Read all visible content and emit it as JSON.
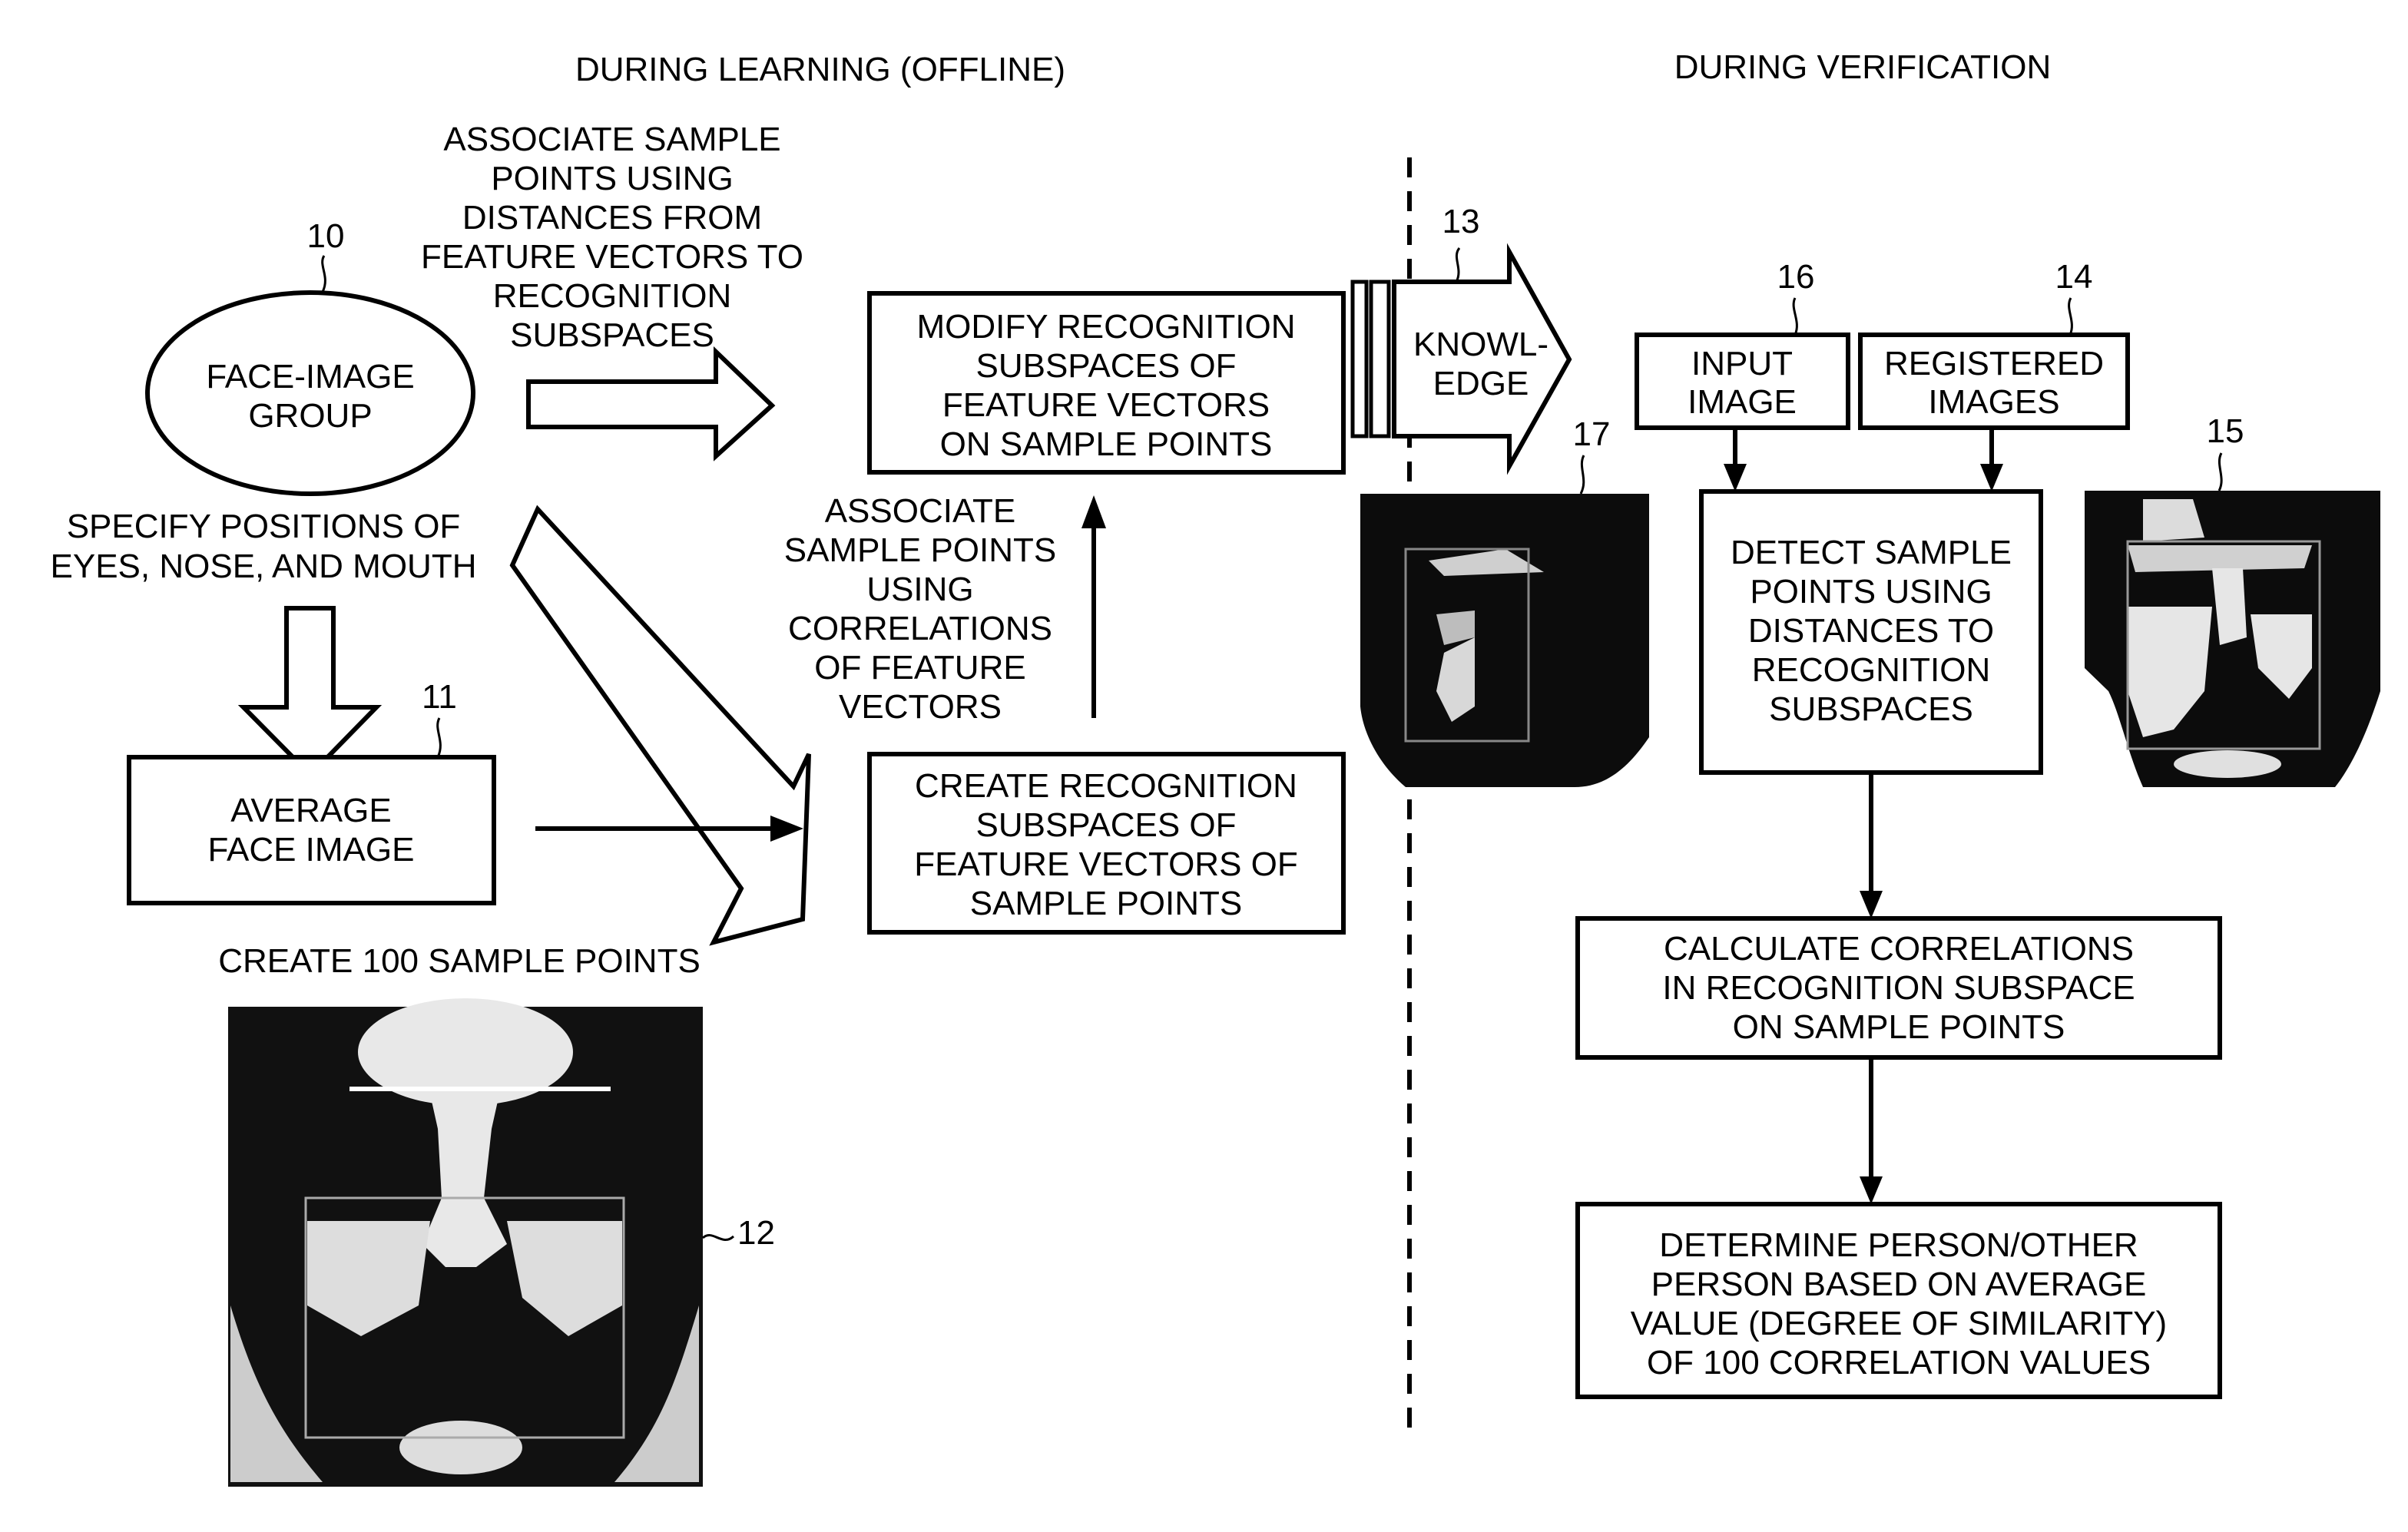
{
  "headers": {
    "learning": "DURING LEARNING (OFFLINE)",
    "verification": "DURING VERIFICATION"
  },
  "learning": {
    "face_image_group": {
      "ref": "10",
      "lines": [
        "FACE-IMAGE",
        "GROUP"
      ]
    },
    "associate_distances": {
      "lines": [
        "ASSOCIATE SAMPLE",
        "POINTS USING",
        "DISTANCES FROM",
        "FEATURE VECTORS TO",
        "RECOGNITION",
        "SUBSPACES"
      ]
    },
    "specify_positions": {
      "lines": [
        "SPECIFY POSITIONS OF",
        "EYES, NOSE, AND MOUTH"
      ]
    },
    "modify_box": {
      "lines": [
        "MODIFY RECOGNITION",
        "SUBSPACES OF",
        "FEATURE VECTORS",
        "ON SAMPLE POINTS"
      ]
    },
    "associate_correlations": {
      "lines": [
        "ASSOCIATE",
        "SAMPLE POINTS",
        "USING",
        "CORRELATIONS",
        "OF FEATURE",
        "VECTORS"
      ]
    },
    "average_face_box": {
      "ref": "11",
      "lines": [
        "AVERAGE",
        "FACE IMAGE"
      ]
    },
    "create_box": {
      "lines": [
        "CREATE RECOGNITION",
        "SUBSPACES OF",
        "FEATURE VECTORS OF",
        "SAMPLE POINTS"
      ]
    },
    "create_sample_points": "CREATE 100 SAMPLE POINTS",
    "average_face_photo": {
      "ref": "12"
    }
  },
  "knowledge": {
    "ref": "13",
    "lines": [
      "KNOWL-",
      "EDGE"
    ]
  },
  "verification": {
    "input_image_box": {
      "ref": "16",
      "lines": [
        "INPUT",
        "IMAGE"
      ]
    },
    "registered_images_box": {
      "ref": "14",
      "lines": [
        "REGISTERED",
        "IMAGES"
      ]
    },
    "input_face_photo": {
      "ref": "17"
    },
    "registered_face_photo": {
      "ref": "15"
    },
    "detect_box": {
      "lines": [
        "DETECT SAMPLE",
        "POINTS USING",
        "DISTANCES TO",
        "RECOGNITION",
        "SUBSPACES"
      ]
    },
    "calculate_box": {
      "lines": [
        "CALCULATE CORRELATIONS",
        "IN RECOGNITION SUBSPACE",
        "ON SAMPLE POINTS"
      ]
    },
    "determine_box": {
      "lines": [
        "DETERMINE PERSON/OTHER",
        "PERSON BASED ON AVERAGE",
        "VALUE (DEGREE OF SIMILARITY)",
        "OF 100 CORRELATION VALUES"
      ]
    }
  }
}
